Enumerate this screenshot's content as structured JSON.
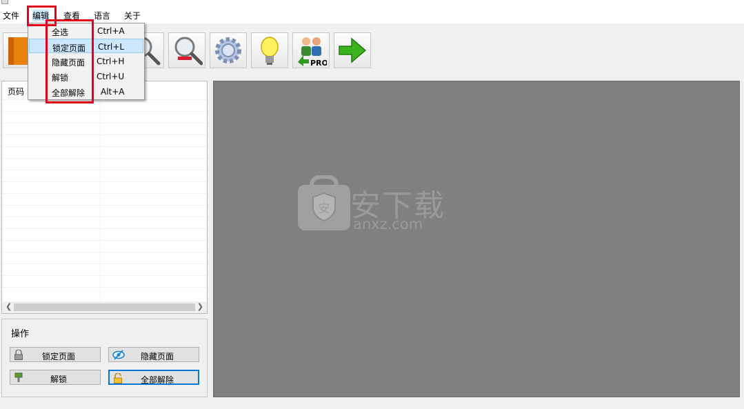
{
  "menubar": {
    "items": [
      {
        "label": "文件"
      },
      {
        "label": "编辑"
      },
      {
        "label": "查看"
      },
      {
        "label": "语言"
      },
      {
        "label": "关于"
      }
    ]
  },
  "dropdown": {
    "items": [
      {
        "label": "全选",
        "shortcut": "Ctrl+A",
        "highlighted": false
      },
      {
        "label": "锁定页面",
        "shortcut": "Ctrl+L",
        "highlighted": true
      },
      {
        "label": "隐藏页面",
        "shortcut": "Ctrl+H",
        "highlighted": false
      },
      {
        "label": "解锁",
        "shortcut": "Ctrl+U",
        "highlighted": false
      },
      {
        "label": "全部解除",
        "shortcut": "Alt+A",
        "highlighted": false
      }
    ]
  },
  "toolbar": {
    "buttons": [
      {
        "icon": "open-file-icon"
      },
      {
        "icon": "zoom-in-icon"
      },
      {
        "icon": "zoom-out-icon"
      },
      {
        "icon": "settings-gear-icon"
      },
      {
        "icon": "lightbulb-icon"
      },
      {
        "icon": "users-pro-icon",
        "badge": "PRO"
      },
      {
        "icon": "arrow-right-icon"
      }
    ]
  },
  "pagelist": {
    "column_header": "页码"
  },
  "operations": {
    "title": "操作",
    "lock_page": "锁定页面",
    "hide_page": "隐藏页面",
    "unlock": "解锁",
    "remove_all": "全部解除"
  },
  "watermark": {
    "shield_char": "安",
    "name": "安下载",
    "domain": "anxz.com"
  },
  "colors": {
    "annotation_red": "#e3001b",
    "highlight": "#cce8ff",
    "preview_bg": "#808080",
    "focus_border": "#0078d7"
  }
}
